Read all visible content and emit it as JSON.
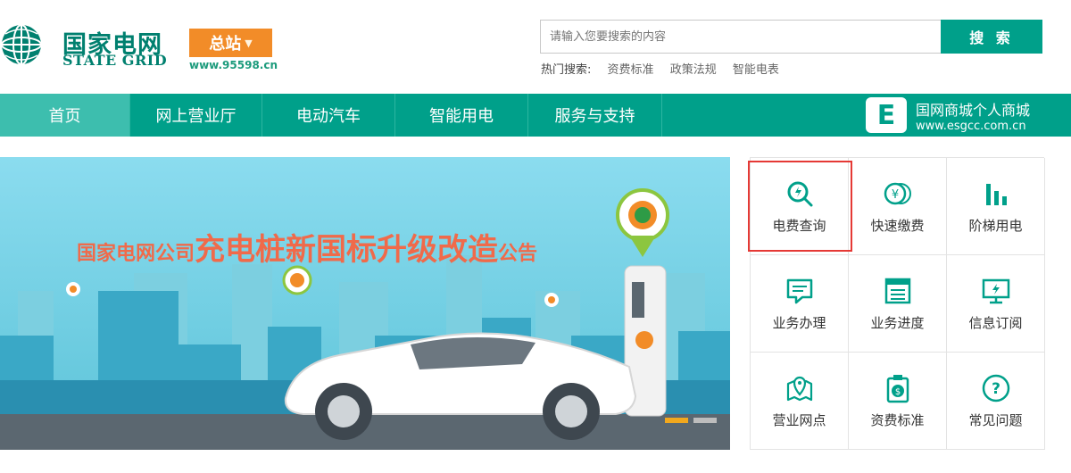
{
  "logo": {
    "cn": "国家电网",
    "en": "STATE GRID",
    "emblem_icon": "state-grid-globe-icon"
  },
  "station": {
    "label": "总站",
    "caret_icon": "caret-down-icon",
    "hotline": "www.95598.cn"
  },
  "search": {
    "placeholder": "请输入您要搜索的内容",
    "button_label": "搜 索",
    "hot_label": "热门搜索:",
    "hot_links": [
      "资费标准",
      "政策法规",
      "智能电表"
    ]
  },
  "nav": {
    "items": [
      "首页",
      "网上营业厅",
      "电动汽车",
      "智能用电",
      "服务与支持"
    ],
    "active_index": 0,
    "mall": {
      "logo_letter": "E",
      "title": "国网商城个人商城",
      "url": "www.esgcc.com.cn"
    }
  },
  "banner": {
    "title_part1": "国家电网公司",
    "title_part2": "充电桩新国标升级改造",
    "title_part3": "公告",
    "dots": 2,
    "active_dot": 0
  },
  "services": [
    {
      "label": "电费查询",
      "icon": "bill-search-icon"
    },
    {
      "label": "快速缴费",
      "icon": "coin-payment-icon"
    },
    {
      "label": "阶梯用电",
      "icon": "bar-chart-icon"
    },
    {
      "label": "业务办理",
      "icon": "message-icon"
    },
    {
      "label": "业务进度",
      "icon": "progress-board-icon"
    },
    {
      "label": "信息订阅",
      "icon": "monitor-icon"
    },
    {
      "label": "营业网点",
      "icon": "map-pin-icon"
    },
    {
      "label": "资费标准",
      "icon": "price-tag-icon"
    },
    {
      "label": "常见问题",
      "icon": "question-icon"
    }
  ],
  "colors": {
    "brand_green": "#00a08a",
    "nav_active": "#3dbeae",
    "station_orange": "#f28c28",
    "highlight_red": "#e53935",
    "banner_title": "#f06a4a",
    "dot_active": "#f2a81d",
    "dot_inactive": "#bdbdbd"
  }
}
